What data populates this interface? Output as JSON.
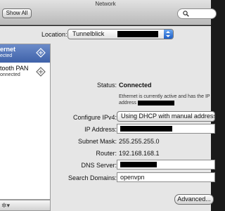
{
  "window": {
    "title": "Network"
  },
  "toolbar": {
    "show_all_label": "Show All",
    "search_icon": "search-icon"
  },
  "location": {
    "label": "Location:",
    "value": "Tunnelblick"
  },
  "sidebar": {
    "items": [
      {
        "name": "ernet",
        "status": "ected",
        "icon": "ethernet-icon",
        "selected": true
      },
      {
        "name": "tooth PAN",
        "status": "onnected",
        "icon": "bluetooth-pan-icon",
        "selected": false
      }
    ],
    "gear_label": "✲▾"
  },
  "detail": {
    "status_label": "Status:",
    "status_value": "Connected",
    "status_description_1": "Ethernet is currently active and has the IP",
    "status_description_2": "address",
    "configure_label": "Configure IPv4:",
    "configure_value": "Using DHCP with manual address",
    "ip_label": "IP Address:",
    "subnet_label": "Subnet Mask:",
    "subnet_value": "255.255.255.0",
    "router_label": "Router:",
    "router_value": "192.168.168.1",
    "dns_label": "DNS Server:",
    "search_domains_label": "Search Domains:",
    "search_domains_value": "openvpn"
  },
  "buttons": {
    "advanced_label": "Advanced..."
  },
  "colors": {
    "selection": "#4f71b6",
    "stepper": "#2f74db"
  }
}
